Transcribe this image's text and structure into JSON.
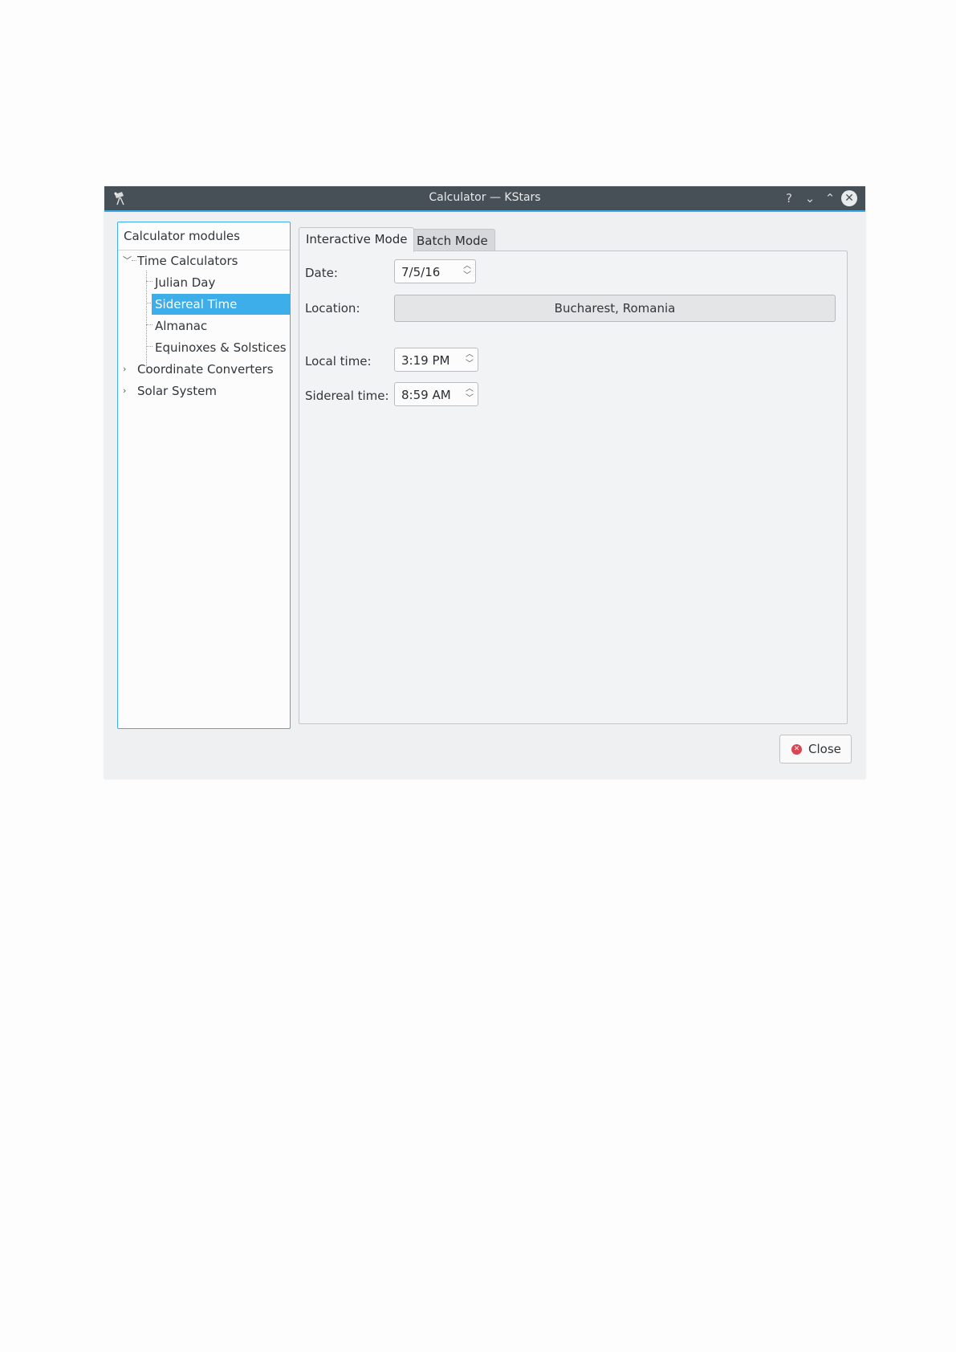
{
  "window": {
    "title": "Calculator — KStars",
    "controls": {
      "help": "?",
      "minimize": "⌄",
      "maximize": "⌃",
      "close": "✕"
    }
  },
  "modules": {
    "header": "Calculator modules",
    "items": [
      {
        "label": "Time Calculators",
        "expanded": true
      },
      {
        "label": "Julian Day"
      },
      {
        "label": "Sidereal Time",
        "selected": true
      },
      {
        "label": "Almanac"
      },
      {
        "label": "Equinoxes & Solstices"
      },
      {
        "label": "Coordinate Converters",
        "expanded": false
      },
      {
        "label": "Solar System",
        "expanded": false
      }
    ]
  },
  "tabs": [
    {
      "label": "Interactive Mode",
      "active": true
    },
    {
      "label": "Batch Mode",
      "active": false
    }
  ],
  "form": {
    "date_label": "Date:",
    "date_value": "7/5/16",
    "location_label": "Location:",
    "location_value": "Bucharest, Romania",
    "local_time_label": "Local time:",
    "local_time_value": "3:19 PM",
    "sidereal_time_label": "Sidereal time:",
    "sidereal_time_value": "8:59 AM"
  },
  "footer": {
    "close_label": "Close"
  },
  "colors": {
    "accent": "#3daee9",
    "titlebar": "#475057",
    "close_icon": "#da4453"
  }
}
